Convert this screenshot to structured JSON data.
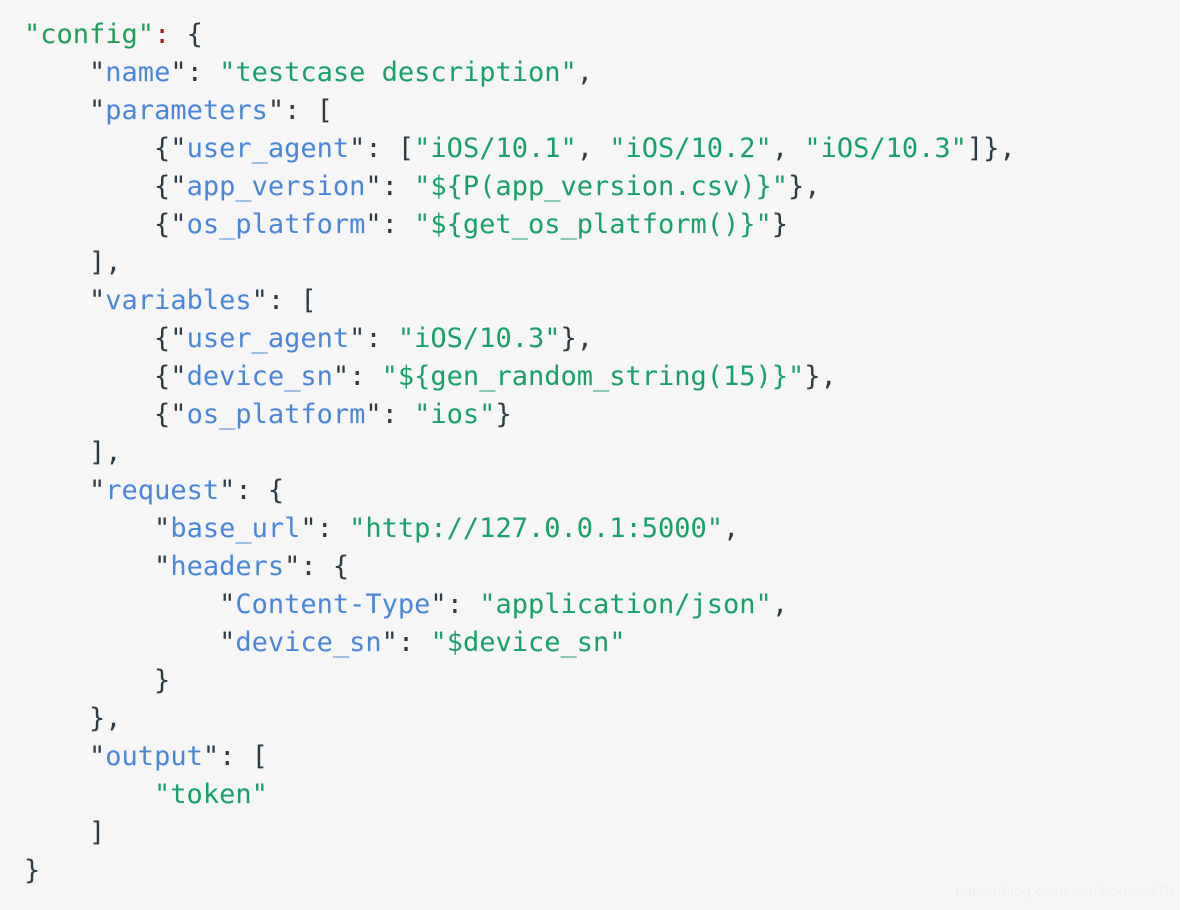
{
  "code_block": {
    "language": "json",
    "background_color": "#f6f6f6",
    "colors": {
      "key": "#4a86d8",
      "top_level_key": "#1f9e5a",
      "string": "#19a06a",
      "punctuation": "#2d3b45",
      "top_level_colon": "#9b2222",
      "watermark": "#efefef"
    },
    "lines": [
      {
        "indent": 0,
        "tokens": [
          {
            "t": "\"config\"",
            "c": "ktop"
          },
          {
            "t": ":",
            "c": "colon-top"
          },
          {
            "t": " {",
            "c": "p"
          }
        ]
      },
      {
        "indent": 1,
        "tokens": [
          {
            "t": "\"",
            "c": "q"
          },
          {
            "t": "name",
            "c": "k"
          },
          {
            "t": "\"",
            "c": "q"
          },
          {
            "t": ": ",
            "c": "p"
          },
          {
            "t": "\"testcase description\"",
            "c": "s"
          },
          {
            "t": ",",
            "c": "p"
          }
        ]
      },
      {
        "indent": 1,
        "tokens": [
          {
            "t": "\"",
            "c": "q"
          },
          {
            "t": "parameters",
            "c": "k"
          },
          {
            "t": "\"",
            "c": "q"
          },
          {
            "t": ": [",
            "c": "p"
          }
        ]
      },
      {
        "indent": 2,
        "tokens": [
          {
            "t": "{\"",
            "c": "p"
          },
          {
            "t": "user_agent",
            "c": "k"
          },
          {
            "t": "\"",
            "c": "q"
          },
          {
            "t": ": [",
            "c": "p"
          },
          {
            "t": "\"iOS/10.1\"",
            "c": "s"
          },
          {
            "t": ", ",
            "c": "p"
          },
          {
            "t": "\"iOS/10.2\"",
            "c": "s"
          },
          {
            "t": ", ",
            "c": "p"
          },
          {
            "t": "\"iOS/10.3\"",
            "c": "s"
          },
          {
            "t": "]},",
            "c": "p"
          }
        ]
      },
      {
        "indent": 2,
        "tokens": [
          {
            "t": "{\"",
            "c": "p"
          },
          {
            "t": "app_version",
            "c": "k"
          },
          {
            "t": "\"",
            "c": "q"
          },
          {
            "t": ": ",
            "c": "p"
          },
          {
            "t": "\"${P(app_version.csv)}\"",
            "c": "s"
          },
          {
            "t": "},",
            "c": "p"
          }
        ]
      },
      {
        "indent": 2,
        "tokens": [
          {
            "t": "{\"",
            "c": "p"
          },
          {
            "t": "os_platform",
            "c": "k"
          },
          {
            "t": "\"",
            "c": "q"
          },
          {
            "t": ": ",
            "c": "p"
          },
          {
            "t": "\"${get_os_platform()}\"",
            "c": "s"
          },
          {
            "t": "}",
            "c": "p"
          }
        ]
      },
      {
        "indent": 1,
        "tokens": [
          {
            "t": "],",
            "c": "p"
          }
        ]
      },
      {
        "indent": 1,
        "tokens": [
          {
            "t": "\"",
            "c": "q"
          },
          {
            "t": "variables",
            "c": "k"
          },
          {
            "t": "\"",
            "c": "q"
          },
          {
            "t": ": [",
            "c": "p"
          }
        ]
      },
      {
        "indent": 2,
        "tokens": [
          {
            "t": "{\"",
            "c": "p"
          },
          {
            "t": "user_agent",
            "c": "k"
          },
          {
            "t": "\"",
            "c": "q"
          },
          {
            "t": ": ",
            "c": "p"
          },
          {
            "t": "\"iOS/10.3\"",
            "c": "s"
          },
          {
            "t": "},",
            "c": "p"
          }
        ]
      },
      {
        "indent": 2,
        "tokens": [
          {
            "t": "{\"",
            "c": "p"
          },
          {
            "t": "device_sn",
            "c": "k"
          },
          {
            "t": "\"",
            "c": "q"
          },
          {
            "t": ": ",
            "c": "p"
          },
          {
            "t": "\"${gen_random_string(15)}\"",
            "c": "s"
          },
          {
            "t": "},",
            "c": "p"
          }
        ]
      },
      {
        "indent": 2,
        "tokens": [
          {
            "t": "{\"",
            "c": "p"
          },
          {
            "t": "os_platform",
            "c": "k"
          },
          {
            "t": "\"",
            "c": "q"
          },
          {
            "t": ": ",
            "c": "p"
          },
          {
            "t": "\"ios\"",
            "c": "s"
          },
          {
            "t": "}",
            "c": "p"
          }
        ]
      },
      {
        "indent": 1,
        "tokens": [
          {
            "t": "],",
            "c": "p"
          }
        ]
      },
      {
        "indent": 1,
        "tokens": [
          {
            "t": "\"",
            "c": "q"
          },
          {
            "t": "request",
            "c": "k"
          },
          {
            "t": "\"",
            "c": "q"
          },
          {
            "t": ": {",
            "c": "p"
          }
        ]
      },
      {
        "indent": 2,
        "tokens": [
          {
            "t": "\"",
            "c": "q"
          },
          {
            "t": "base_url",
            "c": "k"
          },
          {
            "t": "\"",
            "c": "q"
          },
          {
            "t": ": ",
            "c": "p"
          },
          {
            "t": "\"http://127.0.0.1:5000\"",
            "c": "s"
          },
          {
            "t": ",",
            "c": "p"
          }
        ]
      },
      {
        "indent": 2,
        "tokens": [
          {
            "t": "\"",
            "c": "q"
          },
          {
            "t": "headers",
            "c": "k"
          },
          {
            "t": "\"",
            "c": "q"
          },
          {
            "t": ": {",
            "c": "p"
          }
        ]
      },
      {
        "indent": 3,
        "tokens": [
          {
            "t": "\"",
            "c": "q"
          },
          {
            "t": "Content-Type",
            "c": "k"
          },
          {
            "t": "\"",
            "c": "q"
          },
          {
            "t": ": ",
            "c": "p"
          },
          {
            "t": "\"application/json\"",
            "c": "s"
          },
          {
            "t": ",",
            "c": "p"
          }
        ]
      },
      {
        "indent": 3,
        "tokens": [
          {
            "t": "\"",
            "c": "q"
          },
          {
            "t": "device_sn",
            "c": "k"
          },
          {
            "t": "\"",
            "c": "q"
          },
          {
            "t": ": ",
            "c": "p"
          },
          {
            "t": "\"$device_sn\"",
            "c": "s"
          }
        ]
      },
      {
        "indent": 2,
        "tokens": [
          {
            "t": "}",
            "c": "p"
          }
        ]
      },
      {
        "indent": 1,
        "tokens": [
          {
            "t": "},",
            "c": "p"
          }
        ]
      },
      {
        "indent": 1,
        "tokens": [
          {
            "t": "\"",
            "c": "q"
          },
          {
            "t": "output",
            "c": "k"
          },
          {
            "t": "\"",
            "c": "q"
          },
          {
            "t": ": [",
            "c": "p"
          }
        ]
      },
      {
        "indent": 2,
        "tokens": [
          {
            "t": "\"token\"",
            "c": "s"
          }
        ]
      },
      {
        "indent": 1,
        "tokens": [
          {
            "t": "]",
            "c": "p"
          }
        ]
      },
      {
        "indent": 0,
        "tokens": [
          {
            "t": "}",
            "c": "p"
          }
        ]
      }
    ]
  },
  "watermark": {
    "text": "https://blog.csdn.net/luoman876"
  }
}
